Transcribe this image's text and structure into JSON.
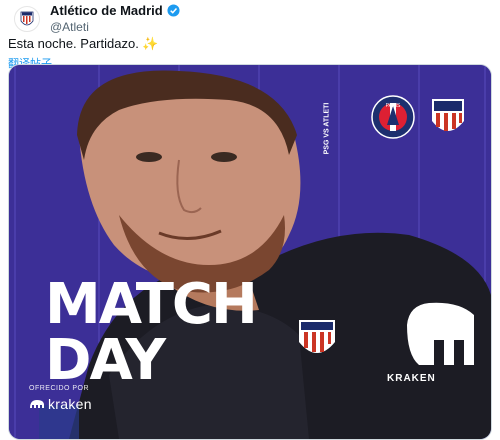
{
  "tweet": {
    "display_name": "Atlético de Madrid",
    "handle": "@Atleti",
    "text": "Esta noche. Partidazo. ✨",
    "translate_label": "翻译帖子"
  },
  "poster": {
    "headline_line1": "MATCH",
    "headline_line2": "DAY",
    "offered_by": "OFRECIDO POR",
    "sponsor": "kraken",
    "shirt_sponsor": "KRAKEN",
    "fixture_home": "PSG",
    "fixture_away": "VS ATLETI",
    "colors": {
      "background": "#3c2f97",
      "accent": "#ffffff",
      "jersey": "#1c1c24"
    }
  },
  "icons": {
    "verified": "verified-badge-icon",
    "avatar": "atletico-crest-icon",
    "home_badge": "psg-crest-icon",
    "away_badge": "atletico-crest-icon"
  }
}
